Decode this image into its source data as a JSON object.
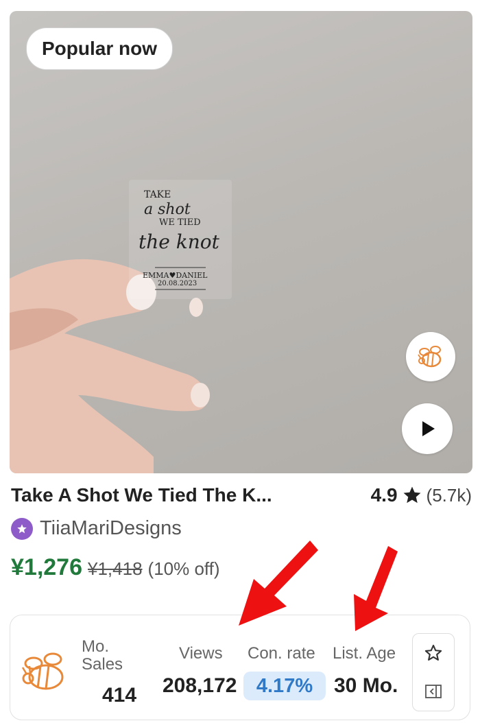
{
  "listing": {
    "badge": "Popular now",
    "title": "Take A Shot We Tied The K...",
    "rating": "4.9",
    "review_count": "(5.7k)",
    "shop_name": "TiiaMariDesigns",
    "price": "¥1,276",
    "original_price": "¥1,418",
    "discount": "(10% off)"
  },
  "product_image": {
    "line1": "TAKE",
    "line2": "a shot",
    "line3": "WE TIED",
    "line4": "the knot",
    "names": "EMMA♥DANIEL",
    "date": "20.08.2023"
  },
  "stats": {
    "mo_sales_label_1": "Mo.",
    "mo_sales_label_2": "Sales",
    "mo_sales_value": "414",
    "views_label": "Views",
    "views_value": "208,172",
    "conv_label": "Con. rate",
    "conv_value": "4.17%",
    "age_label": "List. Age",
    "age_value": "30 Mo."
  },
  "icons": {
    "extension_logo": "bee-icon",
    "play": "play-icon",
    "star": "star-icon",
    "favorite": "star-outline-icon",
    "panel": "sidebar-icon",
    "shop_badge": "star-badge-icon"
  },
  "colors": {
    "price_green": "#217a3c",
    "conv_pill_bg": "#dcebfb",
    "conv_text": "#2f79c7",
    "shop_badge": "#8e5cc9",
    "bee_orange": "#e8893a",
    "annotation_red": "#ee1111"
  }
}
